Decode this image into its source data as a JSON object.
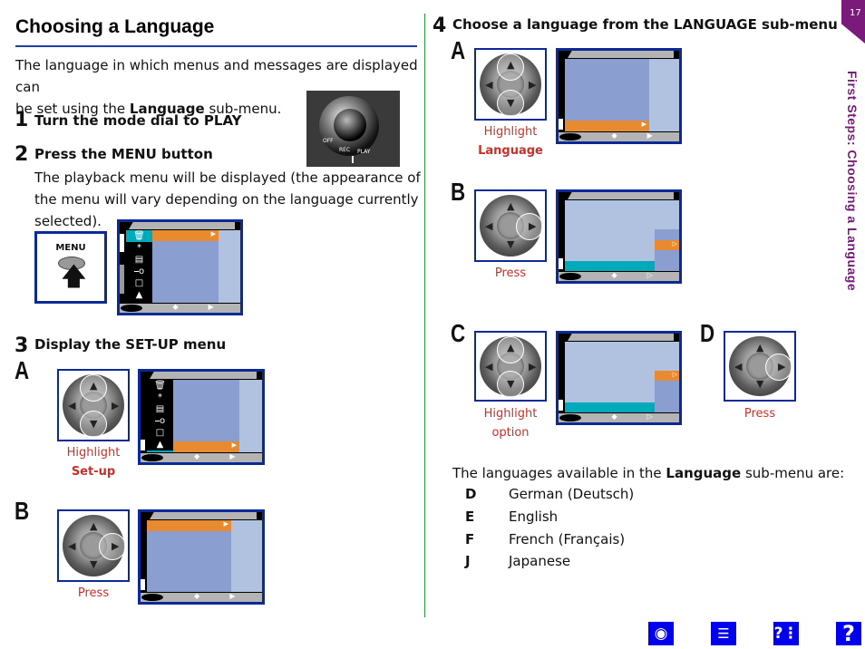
{
  "title": "Choosing a Language",
  "intro": [
    "The language in which menus and messages are displayed can",
    "be set using the ",
    "Language",
    " sub-menu."
  ],
  "steps": [
    {
      "num": "1",
      "heading": "Turn the mode dial to PLAY"
    },
    {
      "num": "2",
      "heading": "Press the MENU button",
      "body": "The playback menu will be displayed (the appearance of the menu will vary depending on the language currently selected)."
    },
    {
      "num": "3",
      "heading": "Display the SET-UP menu"
    },
    {
      "num": "4",
      "heading_pre": "Choose a language from the ",
      "heading_bold": "LANGUAGE",
      "heading_post": " sub-menu"
    }
  ],
  "menu_button_label": "MENU",
  "mode_dial_labels": [
    "OFF",
    "REC",
    "PLAY"
  ],
  "substeps": {
    "s3a": {
      "letter": "A",
      "caption": "Highlight",
      "caption_bold": "Set-up"
    },
    "s3b": {
      "letter": "B",
      "caption": "Press"
    },
    "s4a": {
      "letter": "A",
      "caption": "Highlight",
      "caption_bold": "Language"
    },
    "s4b": {
      "letter": "B",
      "caption": "Press"
    },
    "s4c": {
      "letter": "C",
      "caption": "Highlight",
      "caption2": "option"
    },
    "s4d": {
      "letter": "D",
      "caption": "Press"
    }
  },
  "languages_intro": [
    "The languages available in the ",
    "Language",
    " sub-menu are:"
  ],
  "languages": [
    {
      "code": "D",
      "name": "German (Deutsch)"
    },
    {
      "code": "E",
      "name": "English"
    },
    {
      "code": "F",
      "name": "French (Français)"
    },
    {
      "code": "J",
      "name": "Japanese"
    }
  ],
  "page_number": "17",
  "side_tab": "First Steps: Choosing a Language",
  "nav_icons": [
    "camera-icon",
    "contents-icon",
    "index-icon",
    "help-icon"
  ],
  "colors": {
    "accent_blue": "#0c2a96",
    "purple": "#7a1a7a",
    "orange": "#e88a30",
    "teal": "#00aabb",
    "caption_red": "#c8302a"
  }
}
